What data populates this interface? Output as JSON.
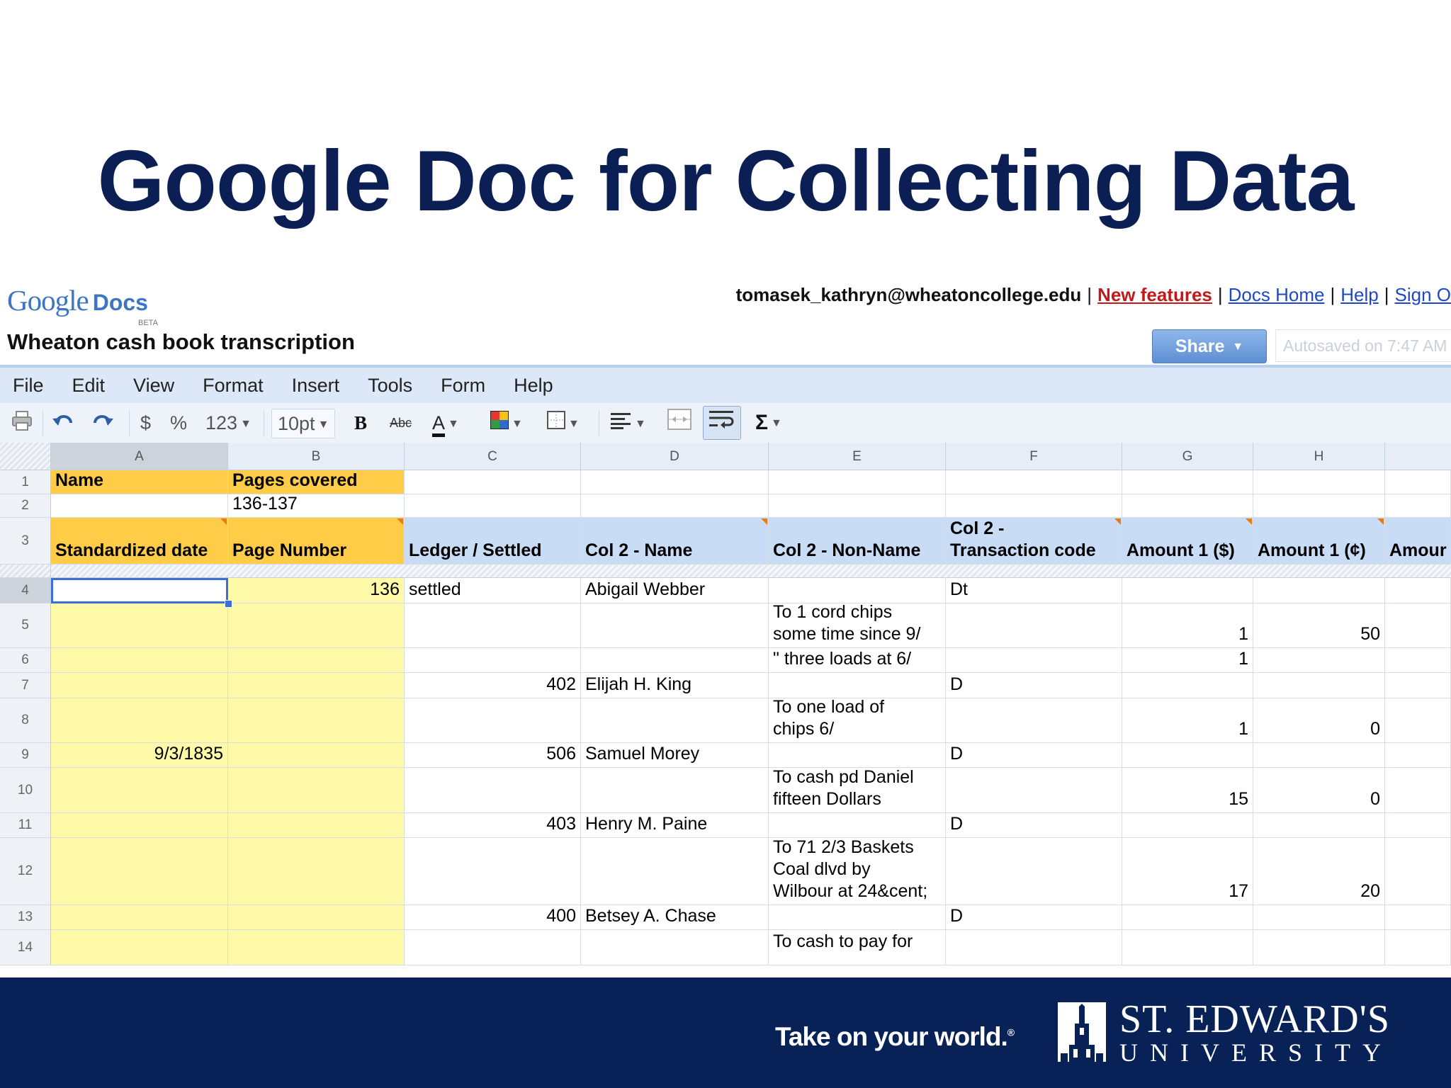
{
  "slide": {
    "title": "Google Doc for Collecting Data"
  },
  "app": {
    "logo_google": "Google",
    "logo_docs": "Docs",
    "logo_beta": "BETA",
    "user_email": "tomasek_kathryn@wheatoncollege.edu",
    "sep": "|",
    "links": {
      "new_features": "New features",
      "docs_home": "Docs Home",
      "help": "Help",
      "sign_out": "Sign O"
    },
    "doc_title": "Wheaton cash book transcription",
    "share_label": "Share",
    "autosave": "Autosaved on 7:47 AM"
  },
  "menu": [
    "File",
    "Edit",
    "View",
    "Format",
    "Insert",
    "Tools",
    "Form",
    "Help"
  ],
  "toolbar": {
    "currency": "$",
    "percent": "%",
    "number_format": "123",
    "font_size": "10pt",
    "bold": "B",
    "strike": "Abc",
    "text_color": "A",
    "sum": "Σ"
  },
  "columns": [
    "A",
    "B",
    "C",
    "D",
    "E",
    "F",
    "G",
    "H"
  ],
  "rows": {
    "r1": {
      "num": "1",
      "A": "Name",
      "B": "Pages covered"
    },
    "r2": {
      "num": "2",
      "B": "136-137"
    },
    "r3": {
      "num": "3",
      "A": "Standardized date",
      "B": "Page Number",
      "C": "Ledger / Settled",
      "D": "Col 2 - Name",
      "E": "Col 2 - Non-Name",
      "F": "Col 2 -\nTransaction code",
      "G": "Amount 1 ($)",
      "H": "Amount 1 (¢)",
      "I": "Amour"
    },
    "r4": {
      "num": "4",
      "B": "136",
      "C": "settled",
      "D": "Abigail Webber",
      "F": "Dt"
    },
    "r5": {
      "num": "5",
      "E": "To 1 cord chips\nsome time since 9/",
      "G": "1",
      "H": "50"
    },
    "r6": {
      "num": "6",
      "E": "\" three loads at 6/",
      "G": "1"
    },
    "r7": {
      "num": "7",
      "C": "402",
      "D": "Elijah H. King",
      "F": "D"
    },
    "r8": {
      "num": "8",
      "E": "To one load of\nchips 6/",
      "G": "1",
      "H": "0"
    },
    "r9": {
      "num": "9",
      "A": "9/3/1835",
      "C": "506",
      "D": "Samuel Morey",
      "F": "D"
    },
    "r10": {
      "num": "10",
      "E": "To cash pd Daniel\nfifteen Dollars",
      "G": "15",
      "H": "0"
    },
    "r11": {
      "num": "11",
      "C": "403",
      "D": "Henry M. Paine",
      "F": "D"
    },
    "r12": {
      "num": "12",
      "E": "To 71 2/3 Baskets\nCoal dlvd by\nWilbour at 24&cent;",
      "G": "17",
      "H": "20"
    },
    "r13": {
      "num": "13",
      "C": "400",
      "D": "Betsey A. Chase",
      "F": "D"
    },
    "r14": {
      "num": "14",
      "E": "To cash to pay for"
    }
  },
  "footer": {
    "tagline": "Take on your world.",
    "tagline_mark": "®",
    "university_name": "ST. EDWARD'S",
    "university_sub": "UNIVERSITY"
  },
  "colors": {
    "header_orange": "#fecc47",
    "header_blue": "#c8dcf5",
    "frozen_yellow": "#fffaa8",
    "footer_navy": "#082257",
    "title_navy": "#0c1f55"
  }
}
